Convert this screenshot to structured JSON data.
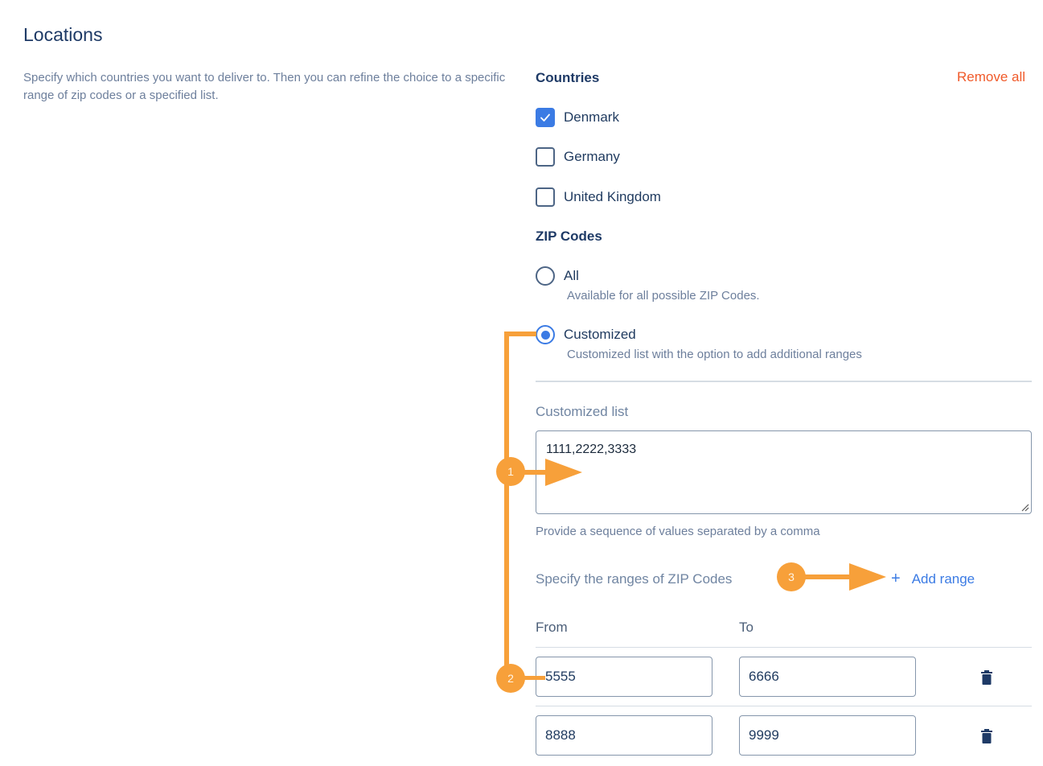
{
  "page": {
    "title": "Locations",
    "description": "Specify which countries you want to deliver to. Then you can refine the choice to a specific range of zip codes or a specified list."
  },
  "countries": {
    "label": "Countries",
    "remove_all_label": "Remove all",
    "items": [
      {
        "label": "Denmark",
        "checked": true
      },
      {
        "label": "Germany",
        "checked": false
      },
      {
        "label": "United Kingdom",
        "checked": false
      }
    ]
  },
  "zip_codes": {
    "label": "ZIP Codes",
    "options": [
      {
        "label": "All",
        "description": "Available for all possible ZIP Codes.",
        "selected": false
      },
      {
        "label": "Customized",
        "description": "Customized list with the option to add additional ranges",
        "selected": true
      }
    ]
  },
  "customized_list": {
    "label": "Customized list",
    "value": "1111,2222,3333",
    "hint": "Provide a sequence of values separated by a comma"
  },
  "ranges": {
    "label": "Specify the ranges of ZIP Codes",
    "add_range_label": "Add range",
    "add_icon": "plus-icon",
    "columns": {
      "from": "From",
      "to": "To"
    },
    "rows": [
      {
        "from": "5555",
        "to": "6666"
      },
      {
        "from": "8888",
        "to": "9999"
      }
    ],
    "delete_icon": "trash-icon"
  },
  "annotations": [
    {
      "number": "1"
    },
    {
      "number": "2"
    },
    {
      "number": "3"
    }
  ],
  "colors": {
    "accent": "#3b7be4",
    "danger": "#f05a2a",
    "annotation": "#f7a03a",
    "heading": "#1e3a66",
    "muted": "#6d7f9c"
  }
}
